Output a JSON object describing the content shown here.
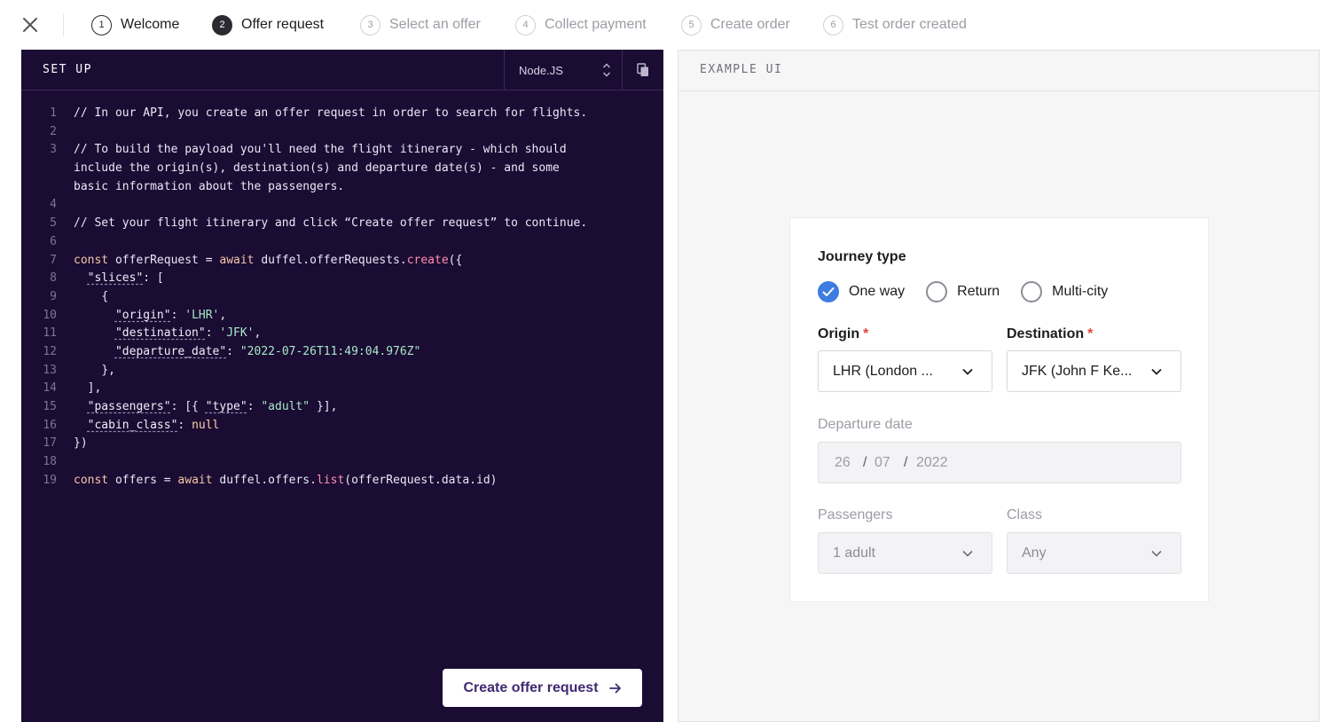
{
  "stepper": {
    "steps": [
      {
        "num": "1",
        "label": "Welcome"
      },
      {
        "num": "2",
        "label": "Offer request"
      },
      {
        "num": "3",
        "label": "Select an offer"
      },
      {
        "num": "4",
        "label": "Collect payment"
      },
      {
        "num": "5",
        "label": "Create order"
      },
      {
        "num": "6",
        "label": "Test order created"
      }
    ],
    "active_step": "2"
  },
  "code_panel": {
    "title": "SET UP",
    "language": "Node.JS",
    "create_button_label": "Create offer request",
    "colors": {
      "background": "#1a0c33",
      "string": "#a9e8c7",
      "function": "#ff8eb2"
    }
  },
  "code_lines": [
    "1",
    "2",
    "3",
    "",
    "",
    "4",
    "5",
    "6",
    "7",
    "8",
    "9",
    "10",
    "11",
    "12",
    "13",
    "14",
    "15",
    "16",
    "17",
    "18",
    "19"
  ],
  "code": {
    "comment1": "// In our API, you create an offer request in order to search for flights.",
    "comment3a": "// To build the payload you'll need the flight itinerary - which should",
    "comment3b": "include the origin(s), destination(s) and departure date(s) - and some",
    "comment3c": "basic information about the passengers.",
    "comment5": "// Set your flight itinerary and click “Create offer request” to continue.",
    "const": "const",
    "await": "await",
    "offerRequest_var": " offerRequest = ",
    "duffel_offerRequests": " duffel.offerRequests.",
    "create_fn": "create",
    "open_call": "({",
    "slices_key": "\"slices\"",
    "slices_rest": ": [",
    "open_brace": "{",
    "origin_key": "\"origin\"",
    "origin_val": "'LHR'",
    "destination_key": "\"destination\"",
    "destination_val": "'JFK'",
    "departure_key": "\"departure_date\"",
    "departure_val": "\"2022-07-26T11:49:04.976Z\"",
    "close_brace": "},",
    "close_bracket": "],",
    "passengers_key": "\"passengers\"",
    "passengers_open": ": [{ ",
    "type_key": "\"type\"",
    "type_val": "\"adult\"",
    "passengers_close": " }],",
    "cabin_key": "\"cabin_class\"",
    "cabin_val": "null",
    "close_call": "})",
    "offers_var": " offers = ",
    "duffel_offers": " duffel.offers.",
    "list_fn": "list",
    "list_args": "(offerRequest.data.id)",
    "colon_sp": ": ",
    "comma": ","
  },
  "example_panel": {
    "title": "EXAMPLE UI",
    "journey_type": {
      "label": "Journey type",
      "options": [
        "One way",
        "Return",
        "Multi-city"
      ],
      "selected": "One way"
    },
    "origin": {
      "label": "Origin",
      "required_mark": "*",
      "value": "LHR (London ..."
    },
    "destination": {
      "label": "Destination",
      "required_mark": "*",
      "value": "JFK (John F Ke..."
    },
    "departure_date": {
      "label": "Departure date",
      "day": "26",
      "month": "07",
      "year": "2022",
      "separator": "/"
    },
    "passengers": {
      "label": "Passengers",
      "value": "1 adult"
    },
    "cabin_class": {
      "label": "Class",
      "value": "Any"
    },
    "colors": {
      "accent": "#3d7ce0",
      "required": "#e0473b"
    }
  }
}
